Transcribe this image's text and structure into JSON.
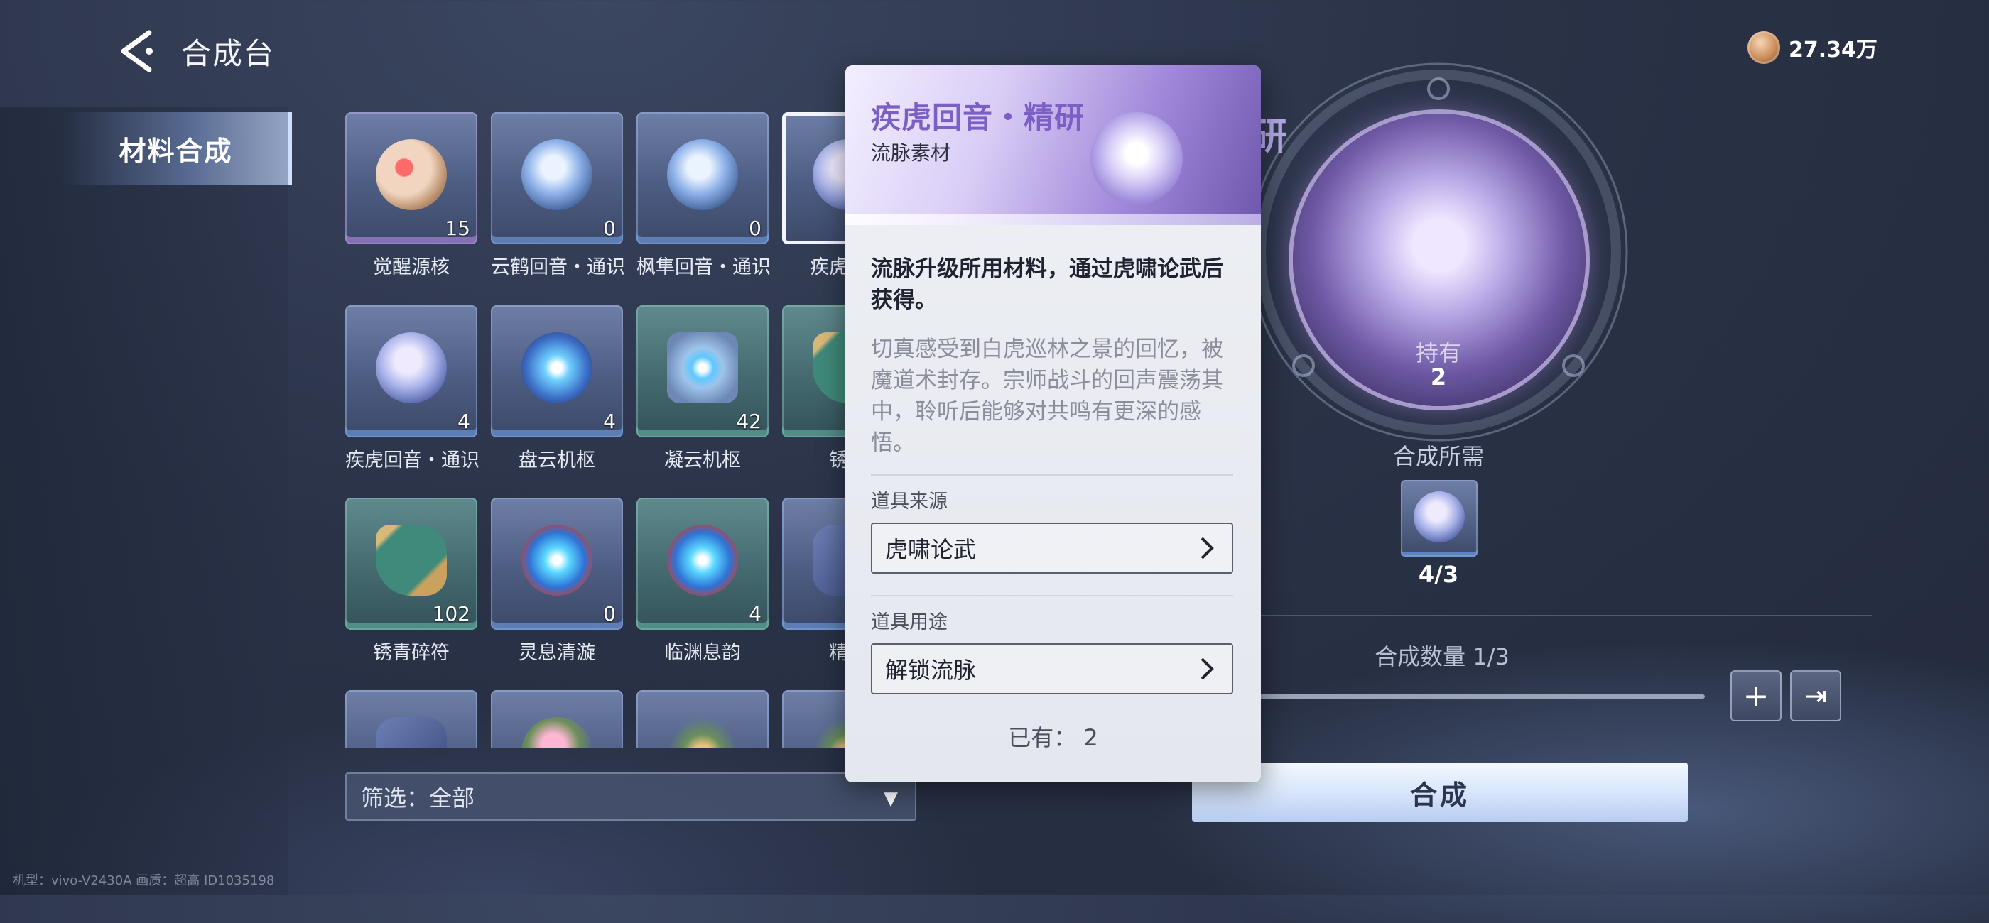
{
  "header": {
    "title": "合成台",
    "currency_value": "27.34万"
  },
  "nav": {
    "active_tab": "材料合成"
  },
  "grid": {
    "items": [
      {
        "name": "觉醒源核",
        "count": "15",
        "icon": "red-core-orb",
        "rarity": "purple"
      },
      {
        "name": "云鹤回音・通识",
        "count": "0",
        "icon": "crane-wing-orb",
        "rarity": "blue"
      },
      {
        "name": "枫隼回音・通识",
        "count": "0",
        "icon": "falcon-orb",
        "rarity": "blue"
      },
      {
        "name": "疾虎回音",
        "count": "",
        "icon": "tiger-orb",
        "rarity": "purple"
      },
      {
        "name": "疾虎回音・通识",
        "count": "4",
        "icon": "tiger-orb",
        "rarity": "blue"
      },
      {
        "name": "盘云机枢",
        "count": "4",
        "icon": "glow-orb",
        "rarity": "blue"
      },
      {
        "name": "凝云机枢",
        "count": "42",
        "icon": "cube-orb",
        "rarity": "green"
      },
      {
        "name": "锈青",
        "count": "",
        "icon": "jade-talisman",
        "rarity": "green"
      },
      {
        "name": "锈青碎符",
        "count": "102",
        "icon": "jade-talisman",
        "rarity": "green"
      },
      {
        "name": "灵息清漩",
        "count": "0",
        "icon": "flame-orb",
        "rarity": "blue"
      },
      {
        "name": "临渊息韵",
        "count": "4",
        "icon": "flame-orb",
        "rarity": "green"
      },
      {
        "name": "精致",
        "count": "",
        "icon": "stone",
        "rarity": "blue"
      },
      {
        "name": "",
        "count": "",
        "icon": "stone",
        "rarity": "blue"
      },
      {
        "name": "",
        "count": "",
        "icon": "lotus",
        "rarity": "blue"
      },
      {
        "name": "",
        "count": "",
        "icon": "fish",
        "rarity": "blue"
      },
      {
        "name": "",
        "count": "",
        "icon": "fish",
        "rarity": "blue"
      }
    ]
  },
  "filter": {
    "label": "筛选：全部"
  },
  "popup": {
    "title": "疾虎回音・精研",
    "subtitle": "流脉素材",
    "description": "流脉升级所用材料，通过虎啸论武后获得。",
    "lore": "切真感受到白虎巡林之景的回忆，被魔道术封存。宗师战斗的回声震荡其中，聆听后能够对共鸣有更深的感悟。",
    "source_label": "道具来源",
    "source_value": "虎啸论武",
    "usage_label": "道具用途",
    "usage_value": "解锁流脉",
    "owned": "已有： 2"
  },
  "detail": {
    "partial_title": "研",
    "hold_label": "持有",
    "hold_value": "2",
    "need_label": "合成所需",
    "need_count": "4/3",
    "quantity_label": "合成数量  1/3",
    "plus_label": "+",
    "max_label": "⇥",
    "compose_label": "合成"
  },
  "footer": {
    "device_info": "机型：vivo-V2430A 画质：超高 ID1035198"
  }
}
